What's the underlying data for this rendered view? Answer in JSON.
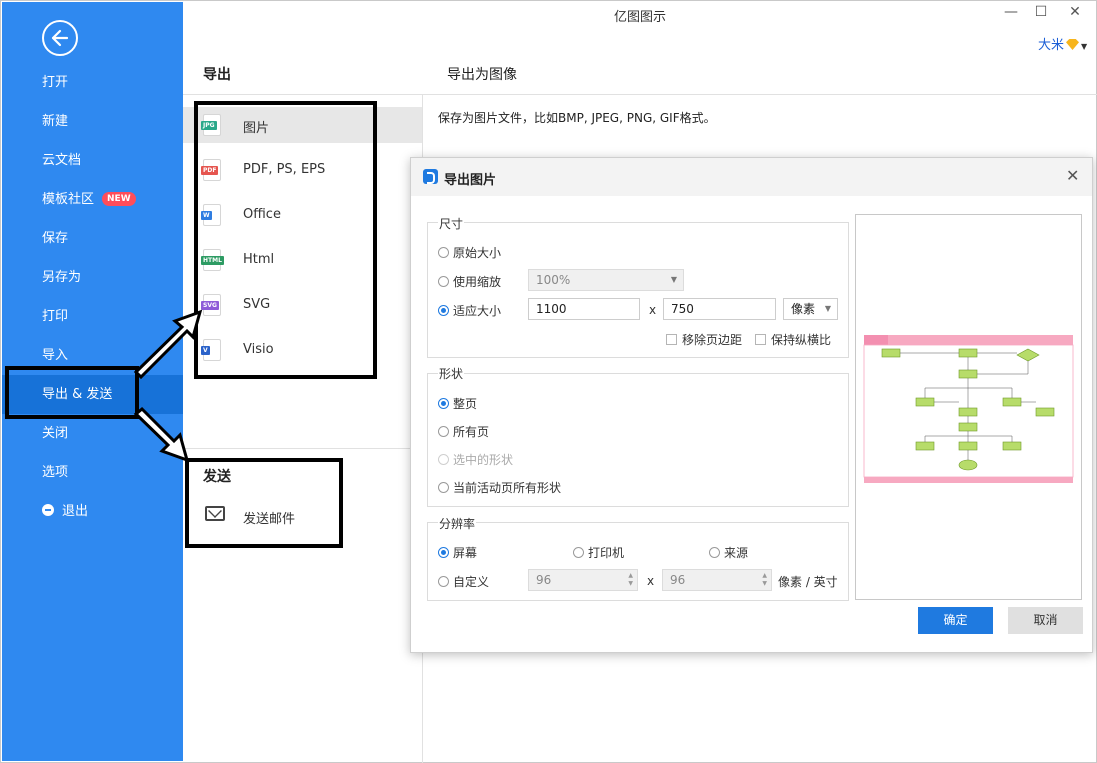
{
  "app": {
    "title": "亿图图示",
    "user_name": "大米",
    "controls": {
      "minimize": "—",
      "maximize": "☐",
      "close": "✕"
    }
  },
  "sidebar": {
    "items": [
      {
        "label": "打开"
      },
      {
        "label": "新建"
      },
      {
        "label": "云文档"
      },
      {
        "label": "模板社区",
        "badge": "NEW"
      },
      {
        "label": "保存"
      },
      {
        "label": "另存为"
      },
      {
        "label": "打印"
      },
      {
        "label": "导入"
      },
      {
        "label": "导出 & 发送",
        "active": true
      },
      {
        "label": "关闭"
      },
      {
        "label": "选项"
      },
      {
        "label": "退出",
        "icon": "exit-icon"
      }
    ]
  },
  "export_panel": {
    "title": "导出",
    "formats": [
      {
        "label": "图片",
        "icon_tag": "JPG",
        "icon_color": "#2aa88a",
        "selected": true
      },
      {
        "label": "PDF, PS, EPS",
        "icon_tag": "PDF",
        "icon_color": "#e5554f"
      },
      {
        "label": "Office",
        "icon_tag": "W",
        "icon_color": "#2f7de1"
      },
      {
        "label": "Html",
        "icon_tag": "HTML",
        "icon_color": "#2d9b63"
      },
      {
        "label": "SVG",
        "icon_tag": "SVG",
        "icon_color": "#8e5bd8"
      },
      {
        "label": "Visio",
        "icon_tag": "V",
        "icon_color": "#2b62c9"
      }
    ],
    "send_title": "发送",
    "send_mail_label": "发送邮件"
  },
  "right_panel": {
    "title": "导出为图像",
    "description": "保存为图片文件，比如BMP, JPEG, PNG, GIF格式。"
  },
  "dialog": {
    "title": "导出图片",
    "size_group": {
      "title": "尺寸",
      "original_label": "原始大小",
      "zoom_label": "使用缩放",
      "zoom_value": "100%",
      "fit_label": "适应大小",
      "width": "1100",
      "x_label": "x",
      "height": "750",
      "unit": "像素",
      "remove_margin_label": "移除页边距",
      "keep_ratio_label": "保持纵横比"
    },
    "shape_group": {
      "title": "形状",
      "whole_page": "整页",
      "all_pages": "所有页",
      "selected_shapes": "选中的形状",
      "current_page_all": "当前活动页所有形状"
    },
    "resolution_group": {
      "title": "分辨率",
      "screen": "屏幕",
      "printer": "打印机",
      "source": "来源",
      "custom": "自定义",
      "dpi_x": "96",
      "x_label": "x",
      "dpi_y": "96",
      "unit": "像素 / 英寸"
    },
    "ok_label": "确定",
    "cancel_label": "取消"
  },
  "colors": {
    "sidebar_bg": "#2f89f0",
    "sidebar_active": "#1772d8",
    "accent": "#1f7ae0",
    "new_badge": "#ff4d5a",
    "preview_header": "#f7a9c1",
    "preview_node": "#b7dc6a"
  }
}
